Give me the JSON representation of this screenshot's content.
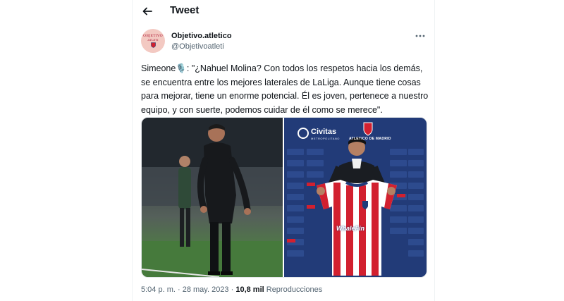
{
  "header": {
    "title": "Tweet",
    "back_icon": "arrow-left-icon"
  },
  "author": {
    "avatar_text_line1": "OBJETIVO",
    "avatar_text_line2": "ATLETI",
    "display_name": "Objetivo.atletico",
    "handle": "@Objetivoatleti"
  },
  "tweet": {
    "text": "Simeone🎙️: \"¿Nahuel Molina? Con todos los respetos hacia los demás, se encuentra entre los mejores laterales de LaLiga. Aunque tiene cosas para mejorar, tiene un enorme potencial. Él es joven, pertenece a nuestro equipo, y con suerte, podemos cuidar de él como se merece\"."
  },
  "media": {
    "left_photo": "Simeone gesturing on the touchline",
    "right_photo": "Player presenting red and white striped jersey",
    "sponsor_text": "Civitas",
    "sponsor_subtext": "METROPOLITANO",
    "stadium_text": "ATLETICO DE MADRID",
    "shirt_sponsor": "WhaleFin"
  },
  "meta": {
    "time": "5:04 p. m.",
    "separator": " · ",
    "date": "28 may. 2023",
    "views_count": "10,8 mil",
    "views_label": "Reproducciones"
  },
  "colors": {
    "text_primary": "#0f1419",
    "text_secondary": "#536471",
    "atletico_red": "#d2202f",
    "backdrop_blue": "#223b78"
  }
}
